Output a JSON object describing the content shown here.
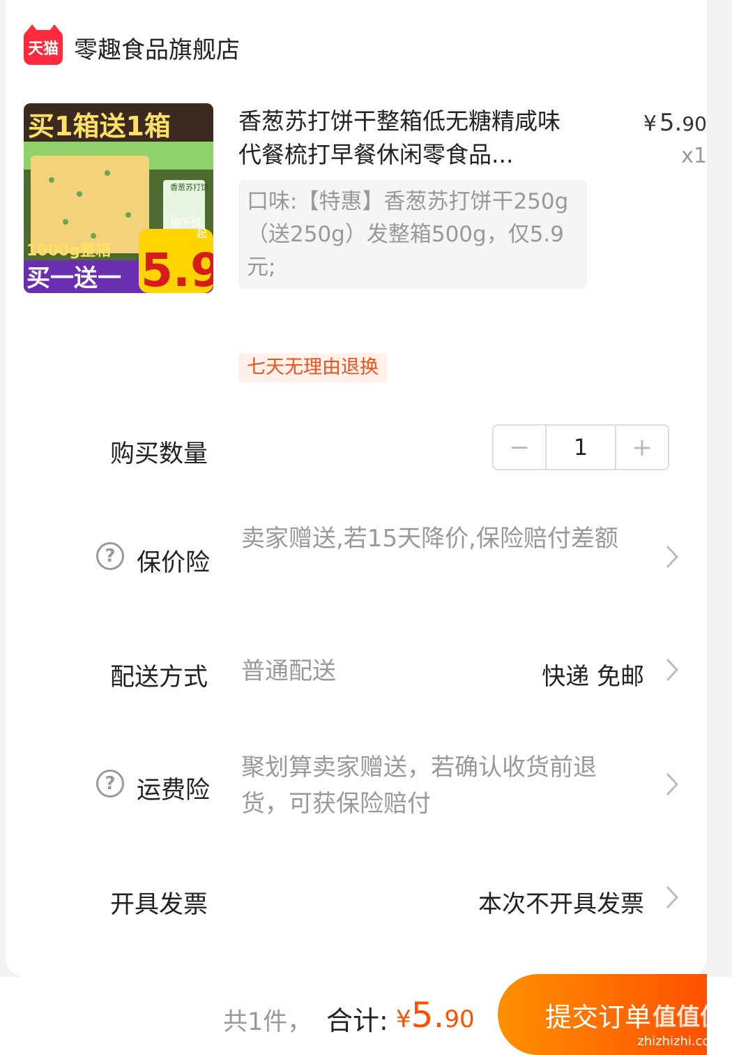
{
  "store": {
    "logo_text": "天猫",
    "name": "零趣食品旗舰店"
  },
  "product": {
    "image_promo_top": "买1箱送1箱",
    "image_weight": "1000g整箱",
    "image_bottom": "买一送一",
    "image_price_small": "拍下仅",
    "image_price_suffix": "起",
    "image_price": "5.9",
    "image_pack_label": "香葱苏打饼",
    "title": "香葱苏打饼干整箱低无糖精咸味代餐梳打早餐休闲零食品...",
    "price_currency": "¥",
    "price_int": "5.",
    "price_dec": "90",
    "quantity_label": "x1",
    "sku_text": "口味:【特惠】香葱苏打饼干250g（送250g）发整箱500g，仅5.9元;",
    "service_tag": "七天无理由退换"
  },
  "quantity": {
    "label": "购买数量",
    "minus": "−",
    "value": "1",
    "plus": "+"
  },
  "price_protection": {
    "help": "?",
    "label": "保价险",
    "value": "卖家赠送,若15天降价,保险赔付差额"
  },
  "delivery": {
    "label": "配送方式",
    "method": "普通配送",
    "value": "快递 免邮"
  },
  "shipping_insurance": {
    "help": "?",
    "label": "运费险",
    "value": "聚划算卖家赠送，若确认收货前退货，可获保险赔付"
  },
  "invoice": {
    "label": "开具发票",
    "value": "本次不开具发票"
  },
  "footer": {
    "count_text": "共1件，",
    "total_label": "合计:",
    "total_currency": "¥",
    "total_int": "5.",
    "total_dec": "90",
    "submit_label": "提交订单"
  },
  "watermark": {
    "main": "值值值",
    "sub": "zhizhizhi.com"
  },
  "colors": {
    "accent": "#ff5000",
    "tmall_red": "#ff2a3d",
    "tag_text": "#f2511b"
  }
}
